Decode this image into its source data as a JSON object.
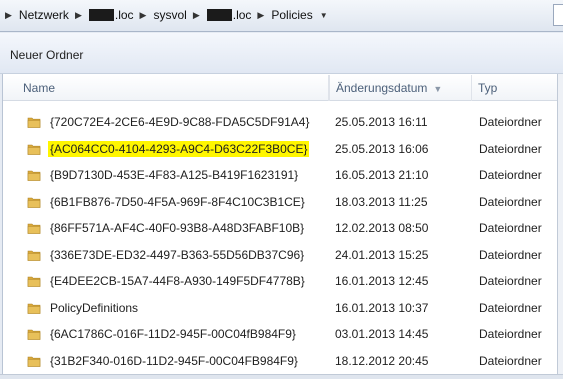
{
  "address_bar": {
    "crumbs": [
      {
        "label": "Netzwerk",
        "redacted_prefix": false
      },
      {
        "label": ".loc",
        "redacted_prefix": true
      },
      {
        "label": "sysvol",
        "redacted_prefix": false
      },
      {
        "label": ".loc",
        "redacted_prefix": true
      },
      {
        "label": "Policies",
        "redacted_prefix": false
      }
    ]
  },
  "toolbar": {
    "new_folder_label": "Neuer Ordner"
  },
  "columns": {
    "name": "Name",
    "date": "Änderungsdatum",
    "type": "Typ"
  },
  "colors": {
    "highlight": "#fff600",
    "folder": "#e8c05a"
  },
  "files": [
    {
      "name": "{720C72E4-2CE6-4E9D-9C88-FDA5C5DF91A4}",
      "date": "25.05.2013 16:11",
      "type": "Dateiordner",
      "highlighted": false,
      "icon": "folder-icon"
    },
    {
      "name": "{AC064CC0-4104-4293-A9C4-D63C22F3B0CE}",
      "date": "25.05.2013 16:06",
      "type": "Dateiordner",
      "highlighted": true,
      "icon": "folder-icon"
    },
    {
      "name": "{B9D7130D-453E-4F83-A125-B419F1623191}",
      "date": "16.05.2013 21:10",
      "type": "Dateiordner",
      "highlighted": false,
      "icon": "folder-icon"
    },
    {
      "name": "{6B1FB876-7D50-4F5A-969F-8F4C10C3B1CE}",
      "date": "18.03.2013 11:25",
      "type": "Dateiordner",
      "highlighted": false,
      "icon": "folder-icon"
    },
    {
      "name": "{86FF571A-AF4C-40F0-93B8-A48D3FABF10B}",
      "date": "12.02.2013 08:50",
      "type": "Dateiordner",
      "highlighted": false,
      "icon": "folder-icon"
    },
    {
      "name": "{336E73DE-ED32-4497-B363-55D56DB37C96}",
      "date": "24.01.2013 15:25",
      "type": "Dateiordner",
      "highlighted": false,
      "icon": "folder-icon"
    },
    {
      "name": "{E4DEE2CB-15A7-44F8-A930-149F5DF4778B}",
      "date": "16.01.2013 12:45",
      "type": "Dateiordner",
      "highlighted": false,
      "icon": "folder-icon"
    },
    {
      "name": "PolicyDefinitions",
      "date": "16.01.2013 10:37",
      "type": "Dateiordner",
      "highlighted": false,
      "icon": "folder-icon"
    },
    {
      "name": "{6AC1786C-016F-11D2-945F-00C04fB984F9}",
      "date": "03.01.2013 14:45",
      "type": "Dateiordner",
      "highlighted": false,
      "icon": "folder-icon"
    },
    {
      "name": "{31B2F340-016D-11D2-945F-00C04FB984F9}",
      "date": "18.12.2012 20:45",
      "type": "Dateiordner",
      "highlighted": false,
      "icon": "folder-icon"
    }
  ]
}
